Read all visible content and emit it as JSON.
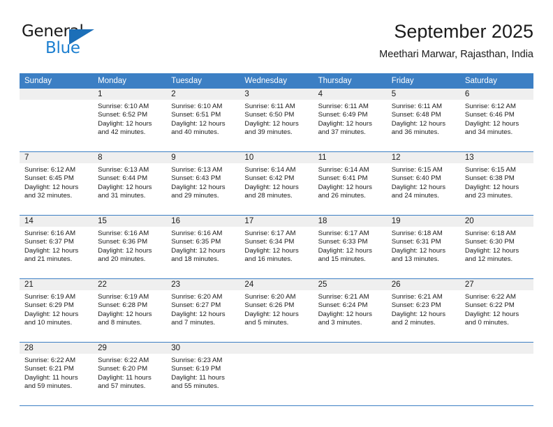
{
  "logo": {
    "primary_text": "General",
    "secondary_text": "Blue",
    "primary_color": "#1a1a1a",
    "secondary_color": "#1c7fd0",
    "triangle_color": "#1c6fb8"
  },
  "header": {
    "title": "September 2025",
    "subtitle": "Meethari Marwar, Rajasthan, India"
  },
  "theme": {
    "header_background": "#3c7fc4",
    "header_text": "#ffffff",
    "daynum_background": "#efefef",
    "row_divider": "#3c7fc4",
    "body_text": "#1a1a1a"
  },
  "weekdays": [
    "Sunday",
    "Monday",
    "Tuesday",
    "Wednesday",
    "Thursday",
    "Friday",
    "Saturday"
  ],
  "weeks": [
    [
      {
        "day": "",
        "sunrise": "",
        "sunset": "",
        "daylight_line1": "",
        "daylight_line2": "",
        "empty": true
      },
      {
        "day": "1",
        "sunrise": "Sunrise: 6:10 AM",
        "sunset": "Sunset: 6:52 PM",
        "daylight_line1": "Daylight: 12 hours",
        "daylight_line2": "and 42 minutes.",
        "empty": false
      },
      {
        "day": "2",
        "sunrise": "Sunrise: 6:10 AM",
        "sunset": "Sunset: 6:51 PM",
        "daylight_line1": "Daylight: 12 hours",
        "daylight_line2": "and 40 minutes.",
        "empty": false
      },
      {
        "day": "3",
        "sunrise": "Sunrise: 6:11 AM",
        "sunset": "Sunset: 6:50 PM",
        "daylight_line1": "Daylight: 12 hours",
        "daylight_line2": "and 39 minutes.",
        "empty": false
      },
      {
        "day": "4",
        "sunrise": "Sunrise: 6:11 AM",
        "sunset": "Sunset: 6:49 PM",
        "daylight_line1": "Daylight: 12 hours",
        "daylight_line2": "and 37 minutes.",
        "empty": false
      },
      {
        "day": "5",
        "sunrise": "Sunrise: 6:11 AM",
        "sunset": "Sunset: 6:48 PM",
        "daylight_line1": "Daylight: 12 hours",
        "daylight_line2": "and 36 minutes.",
        "empty": false
      },
      {
        "day": "6",
        "sunrise": "Sunrise: 6:12 AM",
        "sunset": "Sunset: 6:46 PM",
        "daylight_line1": "Daylight: 12 hours",
        "daylight_line2": "and 34 minutes.",
        "empty": false
      }
    ],
    [
      {
        "day": "7",
        "sunrise": "Sunrise: 6:12 AM",
        "sunset": "Sunset: 6:45 PM",
        "daylight_line1": "Daylight: 12 hours",
        "daylight_line2": "and 32 minutes.",
        "empty": false
      },
      {
        "day": "8",
        "sunrise": "Sunrise: 6:13 AM",
        "sunset": "Sunset: 6:44 PM",
        "daylight_line1": "Daylight: 12 hours",
        "daylight_line2": "and 31 minutes.",
        "empty": false
      },
      {
        "day": "9",
        "sunrise": "Sunrise: 6:13 AM",
        "sunset": "Sunset: 6:43 PM",
        "daylight_line1": "Daylight: 12 hours",
        "daylight_line2": "and 29 minutes.",
        "empty": false
      },
      {
        "day": "10",
        "sunrise": "Sunrise: 6:14 AM",
        "sunset": "Sunset: 6:42 PM",
        "daylight_line1": "Daylight: 12 hours",
        "daylight_line2": "and 28 minutes.",
        "empty": false
      },
      {
        "day": "11",
        "sunrise": "Sunrise: 6:14 AM",
        "sunset": "Sunset: 6:41 PM",
        "daylight_line1": "Daylight: 12 hours",
        "daylight_line2": "and 26 minutes.",
        "empty": false
      },
      {
        "day": "12",
        "sunrise": "Sunrise: 6:15 AM",
        "sunset": "Sunset: 6:40 PM",
        "daylight_line1": "Daylight: 12 hours",
        "daylight_line2": "and 24 minutes.",
        "empty": false
      },
      {
        "day": "13",
        "sunrise": "Sunrise: 6:15 AM",
        "sunset": "Sunset: 6:38 PM",
        "daylight_line1": "Daylight: 12 hours",
        "daylight_line2": "and 23 minutes.",
        "empty": false
      }
    ],
    [
      {
        "day": "14",
        "sunrise": "Sunrise: 6:16 AM",
        "sunset": "Sunset: 6:37 PM",
        "daylight_line1": "Daylight: 12 hours",
        "daylight_line2": "and 21 minutes.",
        "empty": false
      },
      {
        "day": "15",
        "sunrise": "Sunrise: 6:16 AM",
        "sunset": "Sunset: 6:36 PM",
        "daylight_line1": "Daylight: 12 hours",
        "daylight_line2": "and 20 minutes.",
        "empty": false
      },
      {
        "day": "16",
        "sunrise": "Sunrise: 6:16 AM",
        "sunset": "Sunset: 6:35 PM",
        "daylight_line1": "Daylight: 12 hours",
        "daylight_line2": "and 18 minutes.",
        "empty": false
      },
      {
        "day": "17",
        "sunrise": "Sunrise: 6:17 AM",
        "sunset": "Sunset: 6:34 PM",
        "daylight_line1": "Daylight: 12 hours",
        "daylight_line2": "and 16 minutes.",
        "empty": false
      },
      {
        "day": "18",
        "sunrise": "Sunrise: 6:17 AM",
        "sunset": "Sunset: 6:33 PM",
        "daylight_line1": "Daylight: 12 hours",
        "daylight_line2": "and 15 minutes.",
        "empty": false
      },
      {
        "day": "19",
        "sunrise": "Sunrise: 6:18 AM",
        "sunset": "Sunset: 6:31 PM",
        "daylight_line1": "Daylight: 12 hours",
        "daylight_line2": "and 13 minutes.",
        "empty": false
      },
      {
        "day": "20",
        "sunrise": "Sunrise: 6:18 AM",
        "sunset": "Sunset: 6:30 PM",
        "daylight_line1": "Daylight: 12 hours",
        "daylight_line2": "and 12 minutes.",
        "empty": false
      }
    ],
    [
      {
        "day": "21",
        "sunrise": "Sunrise: 6:19 AM",
        "sunset": "Sunset: 6:29 PM",
        "daylight_line1": "Daylight: 12 hours",
        "daylight_line2": "and 10 minutes.",
        "empty": false
      },
      {
        "day": "22",
        "sunrise": "Sunrise: 6:19 AM",
        "sunset": "Sunset: 6:28 PM",
        "daylight_line1": "Daylight: 12 hours",
        "daylight_line2": "and 8 minutes.",
        "empty": false
      },
      {
        "day": "23",
        "sunrise": "Sunrise: 6:20 AM",
        "sunset": "Sunset: 6:27 PM",
        "daylight_line1": "Daylight: 12 hours",
        "daylight_line2": "and 7 minutes.",
        "empty": false
      },
      {
        "day": "24",
        "sunrise": "Sunrise: 6:20 AM",
        "sunset": "Sunset: 6:26 PM",
        "daylight_line1": "Daylight: 12 hours",
        "daylight_line2": "and 5 minutes.",
        "empty": false
      },
      {
        "day": "25",
        "sunrise": "Sunrise: 6:21 AM",
        "sunset": "Sunset: 6:24 PM",
        "daylight_line1": "Daylight: 12 hours",
        "daylight_line2": "and 3 minutes.",
        "empty": false
      },
      {
        "day": "26",
        "sunrise": "Sunrise: 6:21 AM",
        "sunset": "Sunset: 6:23 PM",
        "daylight_line1": "Daylight: 12 hours",
        "daylight_line2": "and 2 minutes.",
        "empty": false
      },
      {
        "day": "27",
        "sunrise": "Sunrise: 6:22 AM",
        "sunset": "Sunset: 6:22 PM",
        "daylight_line1": "Daylight: 12 hours",
        "daylight_line2": "and 0 minutes.",
        "empty": false
      }
    ],
    [
      {
        "day": "28",
        "sunrise": "Sunrise: 6:22 AM",
        "sunset": "Sunset: 6:21 PM",
        "daylight_line1": "Daylight: 11 hours",
        "daylight_line2": "and 59 minutes.",
        "empty": false
      },
      {
        "day": "29",
        "sunrise": "Sunrise: 6:22 AM",
        "sunset": "Sunset: 6:20 PM",
        "daylight_line1": "Daylight: 11 hours",
        "daylight_line2": "and 57 minutes.",
        "empty": false
      },
      {
        "day": "30",
        "sunrise": "Sunrise: 6:23 AM",
        "sunset": "Sunset: 6:19 PM",
        "daylight_line1": "Daylight: 11 hours",
        "daylight_line2": "and 55 minutes.",
        "empty": false
      },
      {
        "day": "",
        "sunrise": "",
        "sunset": "",
        "daylight_line1": "",
        "daylight_line2": "",
        "empty": true
      },
      {
        "day": "",
        "sunrise": "",
        "sunset": "",
        "daylight_line1": "",
        "daylight_line2": "",
        "empty": true
      },
      {
        "day": "",
        "sunrise": "",
        "sunset": "",
        "daylight_line1": "",
        "daylight_line2": "",
        "empty": true
      },
      {
        "day": "",
        "sunrise": "",
        "sunset": "",
        "daylight_line1": "",
        "daylight_line2": "",
        "empty": true
      }
    ]
  ]
}
